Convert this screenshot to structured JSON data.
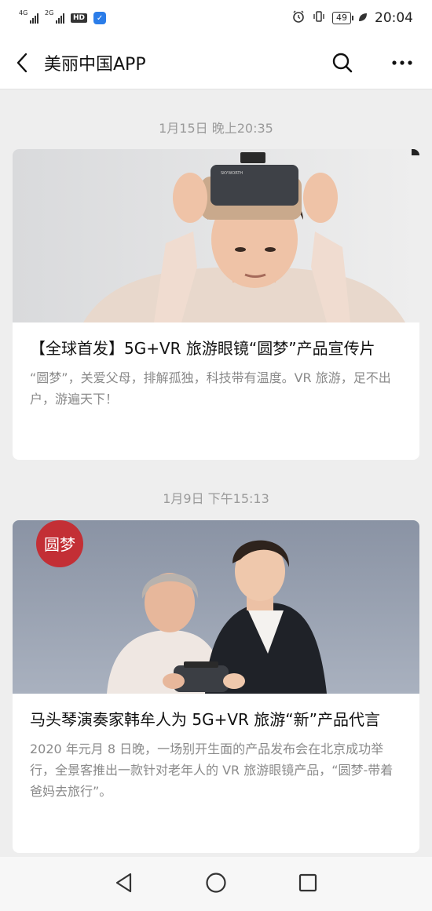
{
  "status_bar": {
    "sim1": "4G",
    "sim2": "2G",
    "hd": "HD",
    "battery": "49",
    "time": "20:04"
  },
  "nav": {
    "title": "美丽中国APP"
  },
  "feed": [
    {
      "timestamp": "1月15日 晚上20:35",
      "title": "【全球首发】5G+VR 旅游眼镜“圆梦”产品宣传片",
      "description": "“圆梦”，关爱父母，排解孤独，科技带有温度。VR 旅游，足不出户，游遍天下！"
    },
    {
      "timestamp": "1月9日 下午15:13",
      "logo_text": "圆梦",
      "title": "马头琴演奏家韩牟人为 5G+VR 旅游“新”产品代言",
      "description": "2020 年元月 8 日晚，一场别开生面的产品发布会在北京成功举行，全景客推出一款针对老年人的 VR 旅游眼镜产品，“圆梦-带着爸妈去旅行”。"
    }
  ],
  "colors": {
    "background": "#eeeeee",
    "card": "#ffffff",
    "timestamp": "#9a9a9a",
    "desc": "#8a8a8a",
    "logo_red": "#c8262b"
  },
  "icons": [
    "back-arrow-icon",
    "search-icon",
    "more-icon",
    "nav-back-icon",
    "nav-home-icon",
    "nav-recent-icon"
  ]
}
